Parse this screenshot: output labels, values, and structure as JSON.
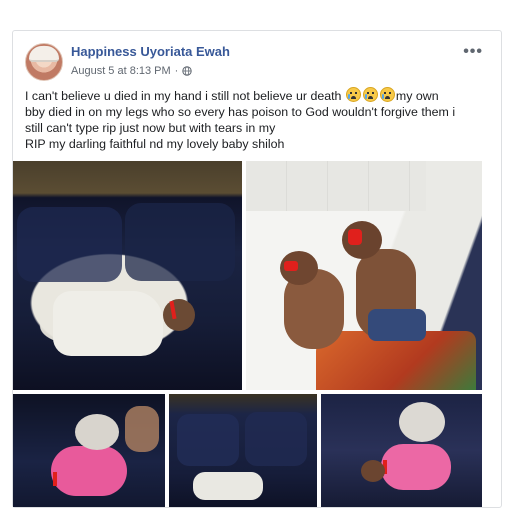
{
  "post": {
    "author": "Happiness Uyoriata Ewah",
    "timestamp": "August 5 at 8:13 PM",
    "separator": "·",
    "privacy_icon": "globe-icon",
    "more_icon": "more-options-icon",
    "more_label": "•••",
    "text_line1_a": "I can't believe u died in my hand i still not believe ur death ",
    "emoji": "loudly-crying-face-emoji",
    "text_line1_b": "my own",
    "text_line2": "bby died in on my legs who so every has poison to God wouldn't forgive them i",
    "text_line3": "still can't type rip just now but with tears in my",
    "text_line4": "RIP my darling faithful nd my lovely baby shiloh"
  },
  "photos": [
    "photo-1",
    "photo-2",
    "photo-3",
    "photo-4",
    "photo-5"
  ],
  "colors": {
    "author": "#385898",
    "meta": "#606770",
    "text": "#1c1e21",
    "border": "#dddfe2",
    "redaction_mark": "#e0201c"
  }
}
